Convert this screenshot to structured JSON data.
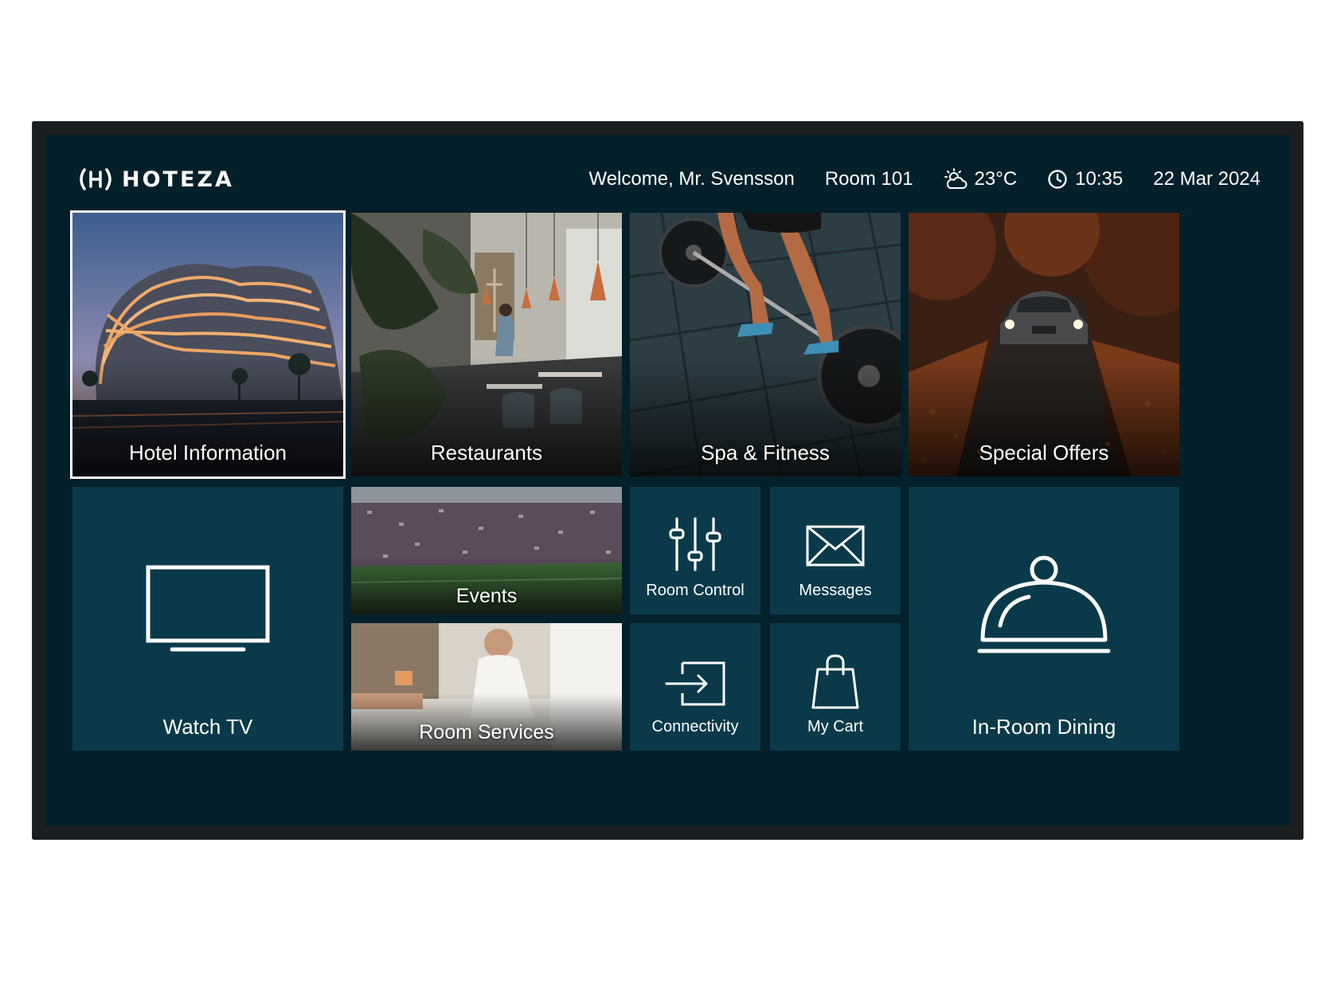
{
  "brand": {
    "name": "HOTEZA",
    "logo_icon": "hoteza-logo-icon"
  },
  "header": {
    "welcome": "Welcome, Mr. Svensson",
    "room": "Room 101",
    "weather_icon": "partly-cloudy-icon",
    "temperature": "23°C",
    "clock_icon": "clock-icon",
    "time": "10:35",
    "date": "22 Mar 2024"
  },
  "tiles": {
    "hotel_info": {
      "label": "Hotel Information",
      "selected": true
    },
    "restaurants": {
      "label": "Restaurants"
    },
    "spa": {
      "label": "Spa & Fitness"
    },
    "offers": {
      "label": "Special Offers"
    },
    "watch_tv": {
      "label": "Watch TV",
      "icon": "tv-icon"
    },
    "events": {
      "label": "Events"
    },
    "room_services": {
      "label": "Room Services"
    },
    "room_control": {
      "label": "Room Control",
      "icon": "sliders-icon"
    },
    "messages": {
      "label": "Messages",
      "icon": "envelope-icon"
    },
    "connectivity": {
      "label": "Connectivity",
      "icon": "input-icon"
    },
    "my_cart": {
      "label": "My Cart",
      "icon": "shopping-bag-icon"
    },
    "in_room_dining": {
      "label": "In-Room Dining",
      "icon": "cloche-icon"
    }
  },
  "colors": {
    "screen_bg": "#03202b",
    "tile_bg": "#0a3a49",
    "bezel": "#1b1e21",
    "text": "#ffffff"
  }
}
